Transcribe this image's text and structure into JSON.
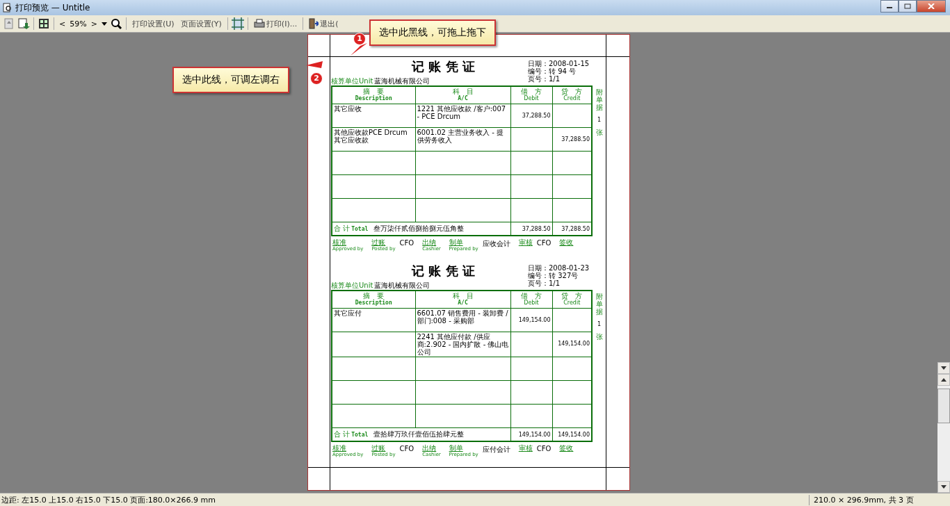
{
  "window": {
    "title": "打印预览 — Untitle"
  },
  "toolbar": {
    "zoom_prev": "<",
    "zoom": "59%",
    "zoom_next": ">",
    "print_setup": "打印设置(U)",
    "page_setup": "页面设置(Y)",
    "print": "打印(I)...",
    "exit": "退出("
  },
  "callouts": [
    {
      "number": "1",
      "text": "选中此黑线，可拖上拖下"
    },
    {
      "number": "2",
      "text": "选中此线，可调左调右"
    }
  ],
  "vouchers": [
    {
      "title": "记 账 凭 证",
      "date": "日期：2008-01-15",
      "number": "编号：转 94 号",
      "page": "页号：1/1",
      "unit_label": "核算单位Unit",
      "unit": "蓝海机械有限公司",
      "columns": [
        {
          "cn": "摘　要",
          "en": "Description"
        },
        {
          "cn": "科　目",
          "en": "A/C"
        },
        {
          "cn": "借　方",
          "en": "Debit"
        },
        {
          "cn": "贷　方",
          "en": "Credit"
        }
      ],
      "rows": [
        {
          "description": "其它应收",
          "account": "1221 其他应收款 /客户:007 - PCE Drcum",
          "debit": "37,288.50",
          "credit": ""
        },
        {
          "description": "其他应收款PCE Drcum其它应收款",
          "account": "6001.02 主营业务收入 - 提供劳务收入",
          "debit": "",
          "credit": "37,288.50"
        },
        {
          "description": "",
          "account": "",
          "debit": "",
          "credit": ""
        },
        {
          "description": "",
          "account": "",
          "debit": "",
          "credit": ""
        },
        {
          "description": "",
          "account": "",
          "debit": "",
          "credit": ""
        }
      ],
      "total_label": "合 计",
      "total_en": "Total",
      "total_words": "叁万柒仟贰佰捌拾捌元伍角整",
      "total_debit": "37,288.50",
      "total_credit": "37,288.50",
      "attachments_label": "附单据",
      "attachments": "1",
      "attachments_unit": "张",
      "signatures": [
        {
          "label": "核准",
          "en": "Approved by"
        },
        {
          "label": "过账",
          "en": "Posted by",
          "value": "CFO"
        },
        {
          "label": "出纳",
          "en": "Cashier"
        },
        {
          "label": "制单",
          "en": "Prepared by",
          "value": "应收会计"
        },
        {
          "label": "审核",
          "value": "CFO"
        },
        {
          "label": "签收"
        }
      ]
    },
    {
      "title": "记 账 凭 证",
      "date": "日期：2008-01-23",
      "number": "编号：转 327号",
      "page": "页号：1/1",
      "unit_label": "核算单位Unit",
      "unit": "蓝海机械有限公司",
      "columns": [
        {
          "cn": "摘　要",
          "en": "Description"
        },
        {
          "cn": "科　目",
          "en": "A/C"
        },
        {
          "cn": "借　方",
          "en": "Debit"
        },
        {
          "cn": "贷　方",
          "en": "Credit"
        }
      ],
      "rows": [
        {
          "description": "其它应付",
          "account": "6601.07 销售费用 - 装卸费 /部门:008 - 采购部",
          "debit": "149,154.00",
          "credit": ""
        },
        {
          "description": "",
          "account": "2241 其他应付款 /供应商:2.902 - 国内扩散 - 佛山电公司",
          "debit": "",
          "credit": "149,154.00"
        },
        {
          "description": "",
          "account": "",
          "debit": "",
          "credit": ""
        },
        {
          "description": "",
          "account": "",
          "debit": "",
          "credit": ""
        },
        {
          "description": "",
          "account": "",
          "debit": "",
          "credit": ""
        }
      ],
      "total_label": "合 计",
      "total_en": "Total",
      "total_words": "壹拾肆万玖仟壹佰伍拾肆元整",
      "total_debit": "149,154.00",
      "total_credit": "149,154.00",
      "attachments_label": "附单据",
      "attachments": "1",
      "attachments_unit": "张",
      "signatures": [
        {
          "label": "核准",
          "en": "Approved by"
        },
        {
          "label": "过账",
          "en": "Posted by",
          "value": "CFO"
        },
        {
          "label": "出纳",
          "en": "Cashier"
        },
        {
          "label": "制单",
          "en": "Prepared by",
          "value": "应付会计"
        },
        {
          "label": "审核",
          "value": "CFO"
        },
        {
          "label": "签收"
        }
      ]
    }
  ],
  "status_bar": {
    "margins": "边距: 左15.0 上15.0 右15.0 下15.0 页面:180.0×266.9 mm",
    "paper": "210.0 × 296.9mm, 共 3 页"
  }
}
